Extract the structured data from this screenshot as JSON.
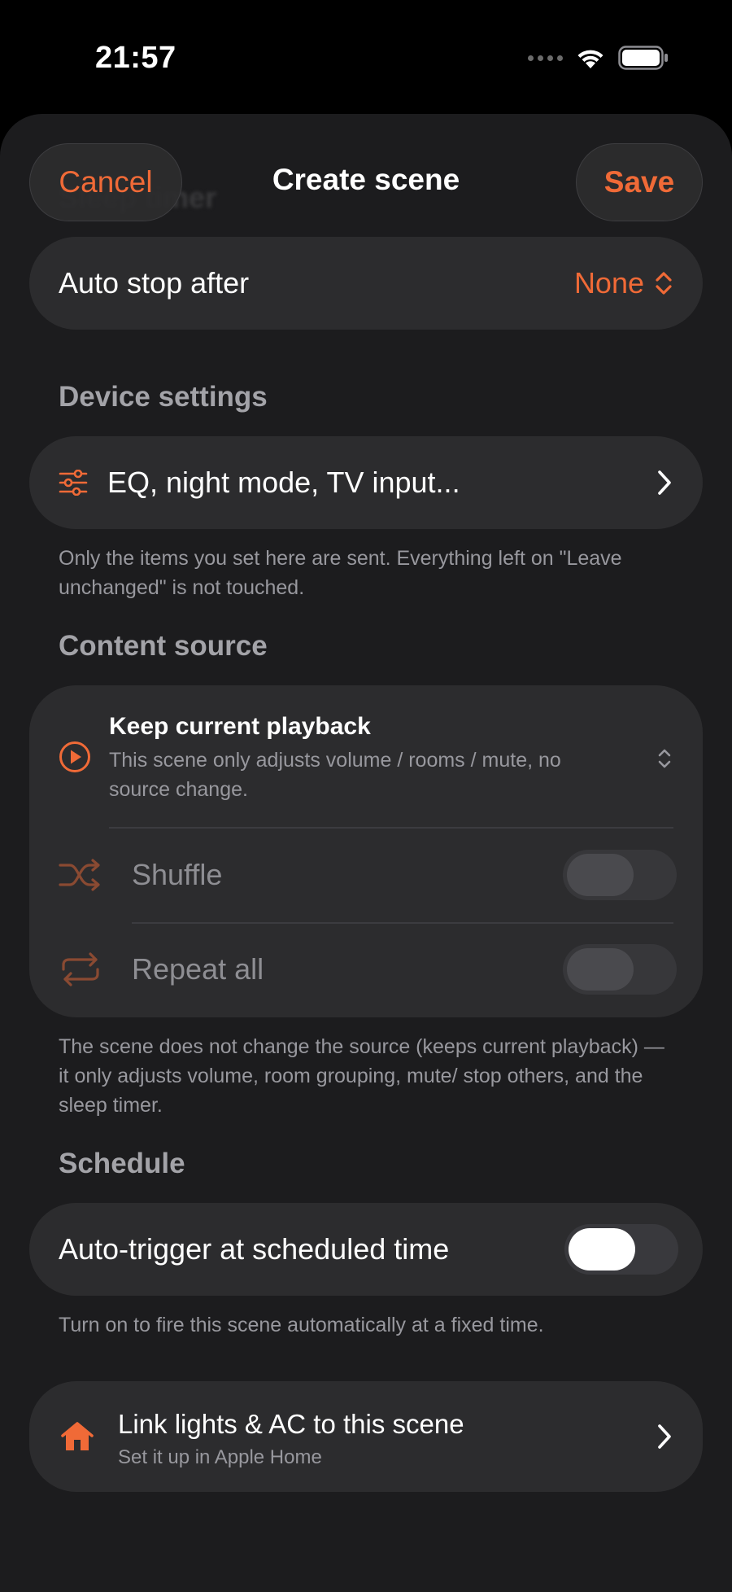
{
  "status_bar": {
    "time": "21:57"
  },
  "header": {
    "ghost_title": "Sleep timer",
    "cancel_label": "Cancel",
    "title": "Create scene",
    "save_label": "Save"
  },
  "auto_stop": {
    "label": "Auto stop after",
    "value": "None"
  },
  "device_settings": {
    "header": "Device settings",
    "row_label": "EQ, night mode, TV input...",
    "footnote": "Only the items you set here are sent. Everything left on \"Leave unchanged\" is not touched."
  },
  "content_source": {
    "header": "Content source",
    "title": "Keep current playback",
    "subtitle": "This scene only adjusts volume / rooms / mute, no source change.",
    "shuffle_label": "Shuffle",
    "shuffle_on": false,
    "repeat_label": "Repeat all",
    "repeat_on": false,
    "footnote": "The scene does not change the source (keeps current playback) — it only adjusts volume, room grouping, mute/ stop others, and the sleep timer."
  },
  "schedule": {
    "header": "Schedule",
    "toggle_label": "Auto-trigger at scheduled time",
    "toggle_on": true,
    "footnote": "Turn on to fire this scene automatically at a fixed time."
  },
  "home_link": {
    "title": "Link lights & AC to this scene",
    "subtitle": "Set it up in Apple Home"
  },
  "colors": {
    "accent": "#f06a37",
    "background": "#000000",
    "sheet": "#1c1c1e",
    "card": "#2c2c2e",
    "secondary_text": "#98989e"
  }
}
